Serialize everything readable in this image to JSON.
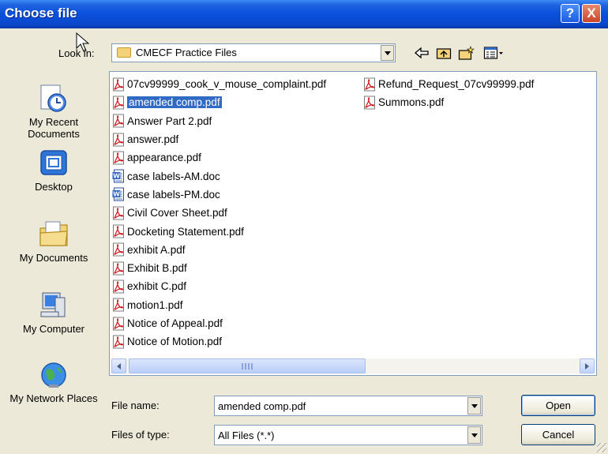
{
  "window": {
    "title": "Choose file",
    "help_glyph": "?",
    "close_glyph": "X"
  },
  "lookin": {
    "label": "Look in:",
    "value": "CMECF Practice Files"
  },
  "places": [
    {
      "label": "My Recent Documents",
      "icon": "recent-documents-icon"
    },
    {
      "label": "Desktop",
      "icon": "desktop-icon"
    },
    {
      "label": "My Documents",
      "icon": "my-documents-icon"
    },
    {
      "label": "My Computer",
      "icon": "my-computer-icon"
    },
    {
      "label": "My Network Places",
      "icon": "network-places-icon"
    }
  ],
  "files_col1": [
    {
      "name": "07cv99999_cook_v_mouse_complaint.pdf",
      "type": "pdf"
    },
    {
      "name": "amended comp.pdf",
      "type": "pdf",
      "selected": true
    },
    {
      "name": "Answer Part 2.pdf",
      "type": "pdf"
    },
    {
      "name": "answer.pdf",
      "type": "pdf"
    },
    {
      "name": "appearance.pdf",
      "type": "pdf"
    },
    {
      "name": "case labels-AM.doc",
      "type": "doc"
    },
    {
      "name": "case labels-PM.doc",
      "type": "doc"
    },
    {
      "name": "Civil Cover Sheet.pdf",
      "type": "pdf"
    },
    {
      "name": "Docketing Statement.pdf",
      "type": "pdf"
    },
    {
      "name": "exhibit A.pdf",
      "type": "pdf"
    },
    {
      "name": "Exhibit B.pdf",
      "type": "pdf"
    },
    {
      "name": "exhibit C.pdf",
      "type": "pdf"
    },
    {
      "name": "motion1.pdf",
      "type": "pdf"
    },
    {
      "name": "Notice of Appeal.pdf",
      "type": "pdf"
    },
    {
      "name": "Notice of Motion.pdf",
      "type": "pdf"
    }
  ],
  "files_col2": [
    {
      "name": "Refund_Request_07cv99999.pdf",
      "type": "pdf"
    },
    {
      "name": "Summons.pdf",
      "type": "pdf"
    }
  ],
  "filename": {
    "label": "File name:",
    "value": "amended comp.pdf"
  },
  "filetype": {
    "label": "Files of type:",
    "value": "All Files (*.*)"
  },
  "buttons": {
    "open": "Open",
    "cancel": "Cancel"
  },
  "colors": {
    "titlebar": "#0a4fdc",
    "selection": "#316ac5",
    "dialog_bg": "#ece9d8"
  }
}
